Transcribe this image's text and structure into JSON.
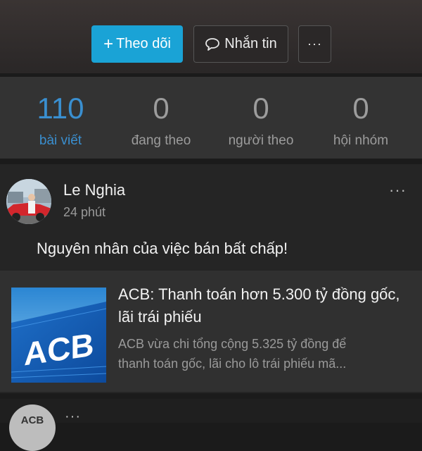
{
  "actions": {
    "follow_label": "Theo dõi",
    "message_label": "Nhắn tin",
    "more_label": "···"
  },
  "stats": [
    {
      "value": "110",
      "label": "bài viết"
    },
    {
      "value": "0",
      "label": "đang theo"
    },
    {
      "value": "0",
      "label": "người theo"
    },
    {
      "value": "0",
      "label": "hội nhóm"
    }
  ],
  "post": {
    "author": "Le Nghia",
    "time": "24 phút",
    "more_label": "···",
    "text": "Nguyên nhân của việc bán bất chấp!",
    "link": {
      "thumb_text": "ACB",
      "title": "ACB: Thanh toán hơn 5.300 tỷ đồng gốc, lãi trái phiếu",
      "description": "ACB vừa chi tổng cộng 5.325 tỷ đồng để\nthanh toán gốc, lãi cho lô trái phiếu mã..."
    }
  },
  "next_post": {
    "avatar_text": "ACB",
    "more_label": "···"
  },
  "colors": {
    "accent": "#1aa3d6",
    "active_stat": "#3a8fd0",
    "background": "#1b1b1b"
  }
}
